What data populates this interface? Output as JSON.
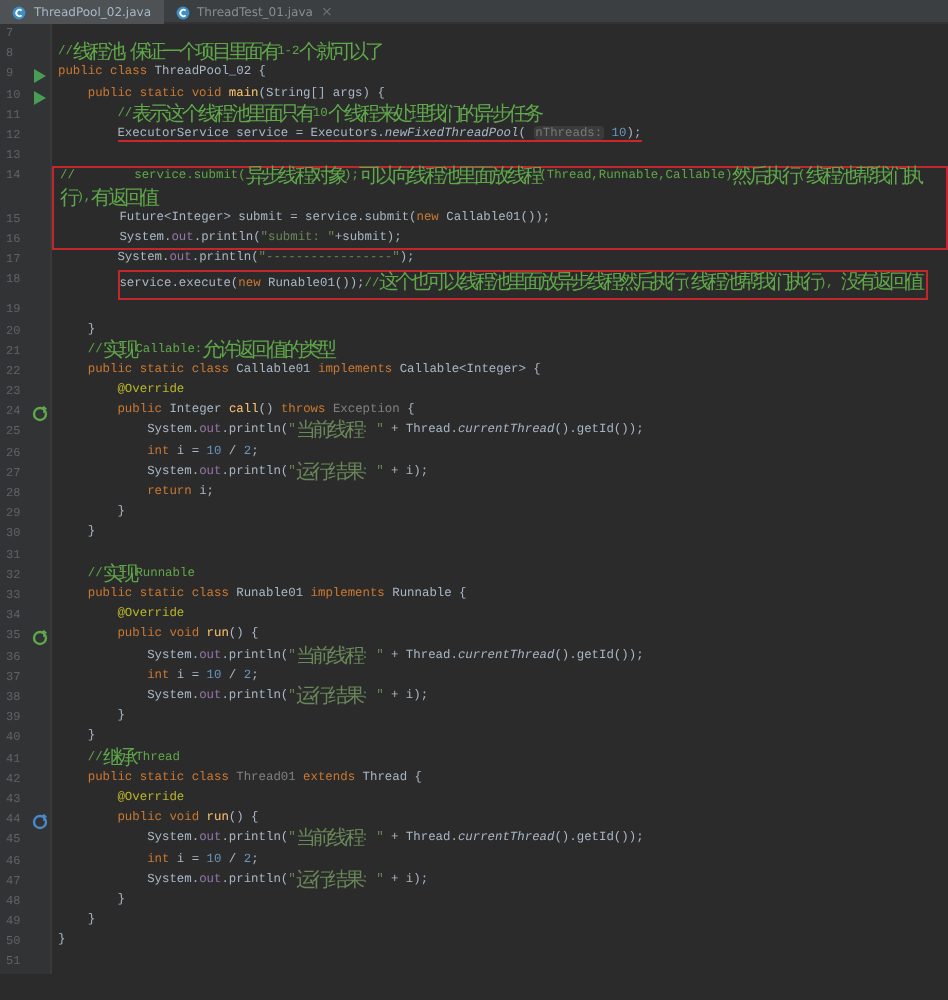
{
  "tabs": [
    {
      "label": "ThreadPool_02.java",
      "selected": true
    },
    {
      "label": "ThreadTest_01.java",
      "selected": false,
      "close": "×"
    }
  ],
  "lines": [
    {
      "number": "7"
    },
    {
      "number": "8",
      "tokens": [
        {
          "kind": "comment",
          "text": "//线程池,保证一个项目里面有1-2个就可以了"
        }
      ]
    },
    {
      "number": "9",
      "marker": {
        "kind": "run"
      },
      "tokens": [
        {
          "kind": "keyword",
          "text": "public class "
        },
        {
          "kind": "plain",
          "text": "ThreadPool_02 {"
        }
      ]
    },
    {
      "number": "10",
      "marker": {
        "kind": "run"
      },
      "tokens": [
        {
          "kind": "keyword",
          "text": "    public static void "
        },
        {
          "kind": "method",
          "text": "main"
        },
        {
          "kind": "plain",
          "text": "(String[] args) {"
        }
      ]
    },
    {
      "number": "11",
      "tokens": [
        {
          "kind": "comment",
          "text": "        //表示这个线程池里面只有10个线程来处理我们的异步任务"
        }
      ]
    },
    {
      "number": "12",
      "underline": true,
      "tokens": [
        {
          "kind": "plain",
          "text": "        ExecutorService service = Executors."
        },
        {
          "kind": "static",
          "text": "newFixedThreadPool"
        },
        {
          "kind": "plain",
          "text": "( "
        },
        {
          "kind": "hint",
          "text": "nThreads:"
        },
        {
          "kind": "number",
          "text": " 10"
        },
        {
          "kind": "plain",
          "text": ");"
        }
      ]
    },
    {
      "number": "13"
    },
    {
      "number": "14",
      "boxed": true,
      "tokens": [
        {
          "kind": "comment",
          "text": "//        service.submit(异步线程对象);可以向线程池里面放线程(Thread,Runnable,Callable)然后执行(线程池帮我们执行),有返回值"
        }
      ]
    },
    {
      "number": "15",
      "boxed": true,
      "tokens": [
        {
          "kind": "plain",
          "text": "        Future<Integer> submit = service.submit("
        },
        {
          "kind": "keyword",
          "text": "new "
        },
        {
          "kind": "plain",
          "text": "Callable01());"
        }
      ]
    },
    {
      "number": "16",
      "boxed": true,
      "tokens": [
        {
          "kind": "plain",
          "text": "        System."
        },
        {
          "kind": "field",
          "text": "out"
        },
        {
          "kind": "plain",
          "text": ".println("
        },
        {
          "kind": "string",
          "text": "\"submit: \""
        },
        {
          "kind": "plain",
          "text": "+submit);"
        }
      ]
    },
    {
      "number": "17",
      "tokens": [
        {
          "kind": "plain",
          "text": "        System."
        },
        {
          "kind": "field",
          "text": "out"
        },
        {
          "kind": "plain",
          "text": ".println("
        },
        {
          "kind": "string",
          "text": "\"-----------------\""
        },
        {
          "kind": "plain",
          "text": ");"
        }
      ]
    },
    {
      "number": "18",
      "boxed": true,
      "tokens": [
        {
          "kind": "plain",
          "text": "        service.execute("
        },
        {
          "kind": "keyword",
          "text": "new "
        },
        {
          "kind": "plain",
          "text": "Runable01());"
        },
        {
          "kind": "comment",
          "text": "//这个也可以线程池里面放异步线程然后执行(线程池帮我们执行), 没有返回值"
        }
      ]
    },
    {
      "number": "19"
    },
    {
      "number": "20",
      "tokens": [
        {
          "kind": "plain",
          "text": "    }"
        }
      ]
    },
    {
      "number": "21",
      "tokens": [
        {
          "kind": "comment",
          "text": "    //实现Callable:允许返回值的类型"
        }
      ]
    },
    {
      "number": "22",
      "tokens": [
        {
          "kind": "keyword",
          "text": "    public static class "
        },
        {
          "kind": "plain",
          "text": "Callable01 "
        },
        {
          "kind": "keyword",
          "text": "implements "
        },
        {
          "kind": "plain",
          "text": "Callable<Integer> {"
        }
      ]
    },
    {
      "number": "23",
      "tokens": [
        {
          "kind": "annotation",
          "text": "        @Override"
        }
      ]
    },
    {
      "number": "24",
      "marker": {
        "kind": "implements"
      },
      "tokens": [
        {
          "kind": "keyword",
          "text": "        public "
        },
        {
          "kind": "plain",
          "text": "Integer "
        },
        {
          "kind": "method",
          "text": "call"
        },
        {
          "kind": "plain",
          "text": "() "
        },
        {
          "kind": "keyword",
          "text": "throws "
        },
        {
          "kind": "muted",
          "text": "Exception"
        },
        {
          "kind": "plain",
          "text": " {"
        }
      ]
    },
    {
      "number": "25",
      "tokens": [
        {
          "kind": "plain",
          "text": "            System."
        },
        {
          "kind": "field",
          "text": "out"
        },
        {
          "kind": "plain",
          "text": ".println("
        },
        {
          "kind": "string",
          "text": "\"当前线程: \""
        },
        {
          "kind": "plain",
          "text": " + Thread."
        },
        {
          "kind": "static",
          "text": "currentThread"
        },
        {
          "kind": "plain",
          "text": "().getId());"
        }
      ]
    },
    {
      "number": "26",
      "tokens": [
        {
          "kind": "keyword",
          "text": "            int "
        },
        {
          "kind": "plain",
          "text": "i = "
        },
        {
          "kind": "number",
          "text": "10"
        },
        {
          "kind": "plain",
          "text": " / "
        },
        {
          "kind": "number",
          "text": "2"
        },
        {
          "kind": "plain",
          "text": ";"
        }
      ]
    },
    {
      "number": "27",
      "tokens": [
        {
          "kind": "plain",
          "text": "            System."
        },
        {
          "kind": "field",
          "text": "out"
        },
        {
          "kind": "plain",
          "text": ".println("
        },
        {
          "kind": "string",
          "text": "\"运行结果: \""
        },
        {
          "kind": "plain",
          "text": " + i);"
        }
      ]
    },
    {
      "number": "28",
      "tokens": [
        {
          "kind": "keyword",
          "text": "            return "
        },
        {
          "kind": "plain",
          "text": "i;"
        }
      ]
    },
    {
      "number": "29",
      "tokens": [
        {
          "kind": "plain",
          "text": "        }"
        }
      ]
    },
    {
      "number": "30",
      "tokens": [
        {
          "kind": "plain",
          "text": "    }"
        }
      ]
    },
    {
      "number": "31"
    },
    {
      "number": "32",
      "tokens": [
        {
          "kind": "comment",
          "text": "    //实现Runnable"
        }
      ]
    },
    {
      "number": "33",
      "tokens": [
        {
          "kind": "keyword",
          "text": "    public static class "
        },
        {
          "kind": "plain",
          "text": "Runable01 "
        },
        {
          "kind": "keyword",
          "text": "implements "
        },
        {
          "kind": "plain",
          "text": "Runnable {"
        }
      ]
    },
    {
      "number": "34",
      "tokens": [
        {
          "kind": "annotation",
          "text": "        @Override"
        }
      ]
    },
    {
      "number": "35",
      "marker": {
        "kind": "implements"
      },
      "tokens": [
        {
          "kind": "keyword",
          "text": "        public void "
        },
        {
          "kind": "method",
          "text": "run"
        },
        {
          "kind": "plain",
          "text": "() {"
        }
      ]
    },
    {
      "number": "36",
      "tokens": [
        {
          "kind": "plain",
          "text": "            System."
        },
        {
          "kind": "field",
          "text": "out"
        },
        {
          "kind": "plain",
          "text": ".println("
        },
        {
          "kind": "string",
          "text": "\"当前线程: \""
        },
        {
          "kind": "plain",
          "text": " + Thread."
        },
        {
          "kind": "static",
          "text": "currentThread"
        },
        {
          "kind": "plain",
          "text": "().getId());"
        }
      ]
    },
    {
      "number": "37",
      "tokens": [
        {
          "kind": "keyword",
          "text": "            int "
        },
        {
          "kind": "plain",
          "text": "i = "
        },
        {
          "kind": "number",
          "text": "10"
        },
        {
          "kind": "plain",
          "text": " / "
        },
        {
          "kind": "number",
          "text": "2"
        },
        {
          "kind": "plain",
          "text": ";"
        }
      ]
    },
    {
      "number": "38",
      "tokens": [
        {
          "kind": "plain",
          "text": "            System."
        },
        {
          "kind": "field",
          "text": "out"
        },
        {
          "kind": "plain",
          "text": ".println("
        },
        {
          "kind": "string",
          "text": "\"运行结果: \""
        },
        {
          "kind": "plain",
          "text": " + i);"
        }
      ]
    },
    {
      "number": "39",
      "tokens": [
        {
          "kind": "plain",
          "text": "        }"
        }
      ]
    },
    {
      "number": "40",
      "tokens": [
        {
          "kind": "plain",
          "text": "    }"
        }
      ]
    },
    {
      "number": "41",
      "tokens": [
        {
          "kind": "comment",
          "text": "    //继承Thread"
        }
      ]
    },
    {
      "number": "42",
      "tokens": [
        {
          "kind": "keyword",
          "text": "    public static class "
        },
        {
          "kind": "muted",
          "text": "Thread01 "
        },
        {
          "kind": "keyword",
          "text": "extends "
        },
        {
          "kind": "plain",
          "text": "Thread {"
        }
      ]
    },
    {
      "number": "43",
      "tokens": [
        {
          "kind": "annotation",
          "text": "        @Override"
        }
      ]
    },
    {
      "number": "44",
      "marker": {
        "kind": "overrides"
      },
      "tokens": [
        {
          "kind": "keyword",
          "text": "        public void "
        },
        {
          "kind": "method",
          "text": "run"
        },
        {
          "kind": "plain",
          "text": "() {"
        }
      ]
    },
    {
      "number": "45",
      "tokens": [
        {
          "kind": "plain",
          "text": "            System."
        },
        {
          "kind": "field",
          "text": "out"
        },
        {
          "kind": "plain",
          "text": ".println("
        },
        {
          "kind": "string",
          "text": "\"当前线程: \""
        },
        {
          "kind": "plain",
          "text": " + Thread."
        },
        {
          "kind": "static",
          "text": "currentThread"
        },
        {
          "kind": "plain",
          "text": "().getId());"
        }
      ]
    },
    {
      "number": "46",
      "tokens": [
        {
          "kind": "keyword",
          "text": "            int "
        },
        {
          "kind": "plain",
          "text": "i = "
        },
        {
          "kind": "number",
          "text": "10"
        },
        {
          "kind": "plain",
          "text": " / "
        },
        {
          "kind": "number",
          "text": "2"
        },
        {
          "kind": "plain",
          "text": ";"
        }
      ]
    },
    {
      "number": "47",
      "tokens": [
        {
          "kind": "plain",
          "text": "            System."
        },
        {
          "kind": "field",
          "text": "out"
        },
        {
          "kind": "plain",
          "text": ".println("
        },
        {
          "kind": "string",
          "text": "\"运行结果: \""
        },
        {
          "kind": "plain",
          "text": " + i);"
        }
      ]
    },
    {
      "number": "48",
      "tokens": [
        {
          "kind": "plain",
          "text": "        }"
        }
      ]
    },
    {
      "number": "49",
      "tokens": [
        {
          "kind": "plain",
          "text": "    }"
        }
      ]
    },
    {
      "number": "50",
      "tokens": [
        {
          "kind": "plain",
          "text": "}"
        }
      ]
    },
    {
      "number": "51"
    }
  ]
}
